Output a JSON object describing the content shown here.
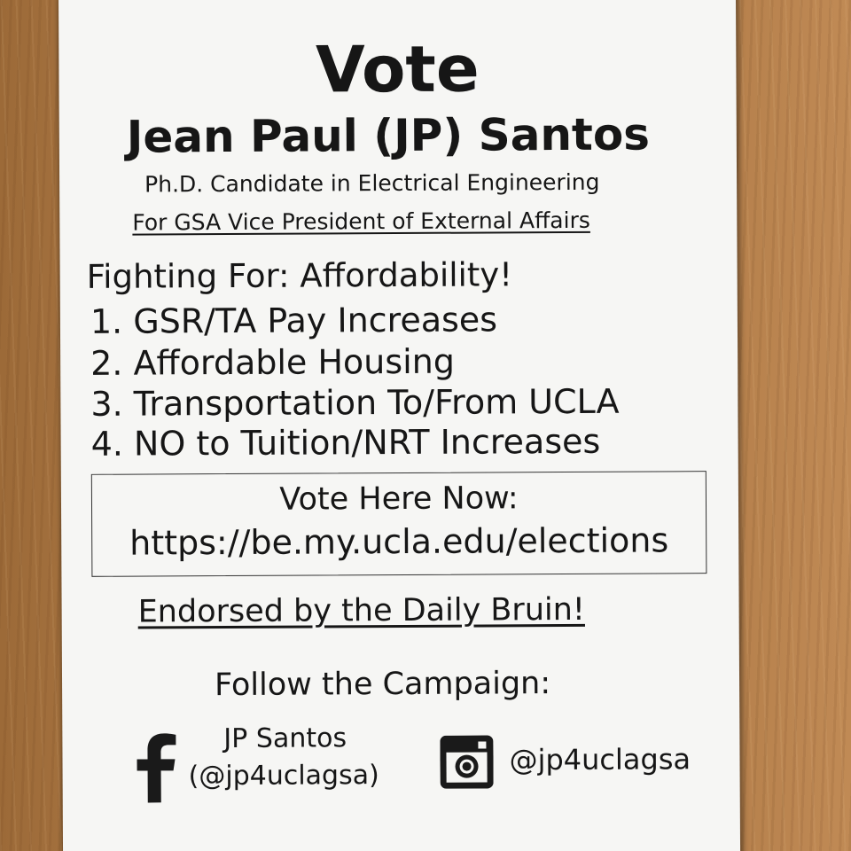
{
  "flyer": {
    "heading": "Vote",
    "candidate_name": "Jean Paul (JP) Santos",
    "candidate_degree": "Ph.D. Candidate in Electrical Engineering",
    "candidate_office": "For GSA Vice President of External Affairs",
    "platform": {
      "heading": "Fighting For: Affordability!",
      "items": [
        "1. GSR/TA Pay Increases",
        "2. Affordable Housing",
        "3. Transportation To/From UCLA",
        "4. NO to Tuition/NRT Increases"
      ]
    },
    "vote_box": {
      "label": "Vote Here Now:",
      "url": "https://be.my.ucla.edu/elections"
    },
    "endorsement": "Endorsed by the Daily Bruin!",
    "follow": {
      "heading": "Follow the Campaign:",
      "facebook": {
        "icon": "facebook-icon",
        "name": "JP Santos",
        "handle": "(@jp4uclagsa)"
      },
      "instagram": {
        "icon": "instagram-icon",
        "handle": "@jp4uclagsa"
      }
    }
  },
  "colors": {
    "paper": "#f6f6f4",
    "ink": "#161616",
    "table_wood": "#b07a44"
  }
}
